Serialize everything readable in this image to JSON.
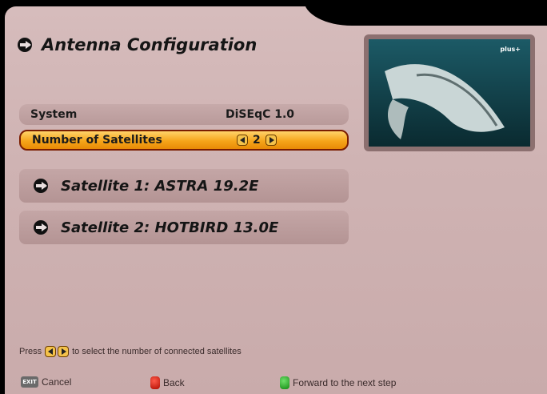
{
  "header": {
    "title": "Antenna Configuration"
  },
  "settings": {
    "system_label": "System",
    "system_value": "DiSEqC 1.0",
    "sats_label": "Number of Satellites",
    "sats_value": "2"
  },
  "satellites": [
    {
      "label": "Satellite 1: ASTRA 19.2E"
    },
    {
      "label": "Satellite 2: HOTBIRD 13.0E"
    }
  ],
  "preview": {
    "logo": "plus+"
  },
  "hint": {
    "prefix": "Press",
    "suffix": "to select the number of connected satellites"
  },
  "footer": {
    "exit_key": "EXIT",
    "cancel": "Cancel",
    "back": "Back",
    "forward": "Forward to the next step"
  },
  "colors": {
    "highlight": "#f6a51a",
    "panel": "#d0b5b5",
    "red": "#d01a0a",
    "green": "#20a020"
  },
  "icons": [
    "arrow-right-icon",
    "left-arrow-key-icon",
    "right-arrow-key-icon",
    "exit-key-icon",
    "red-button-icon",
    "green-button-icon"
  ]
}
